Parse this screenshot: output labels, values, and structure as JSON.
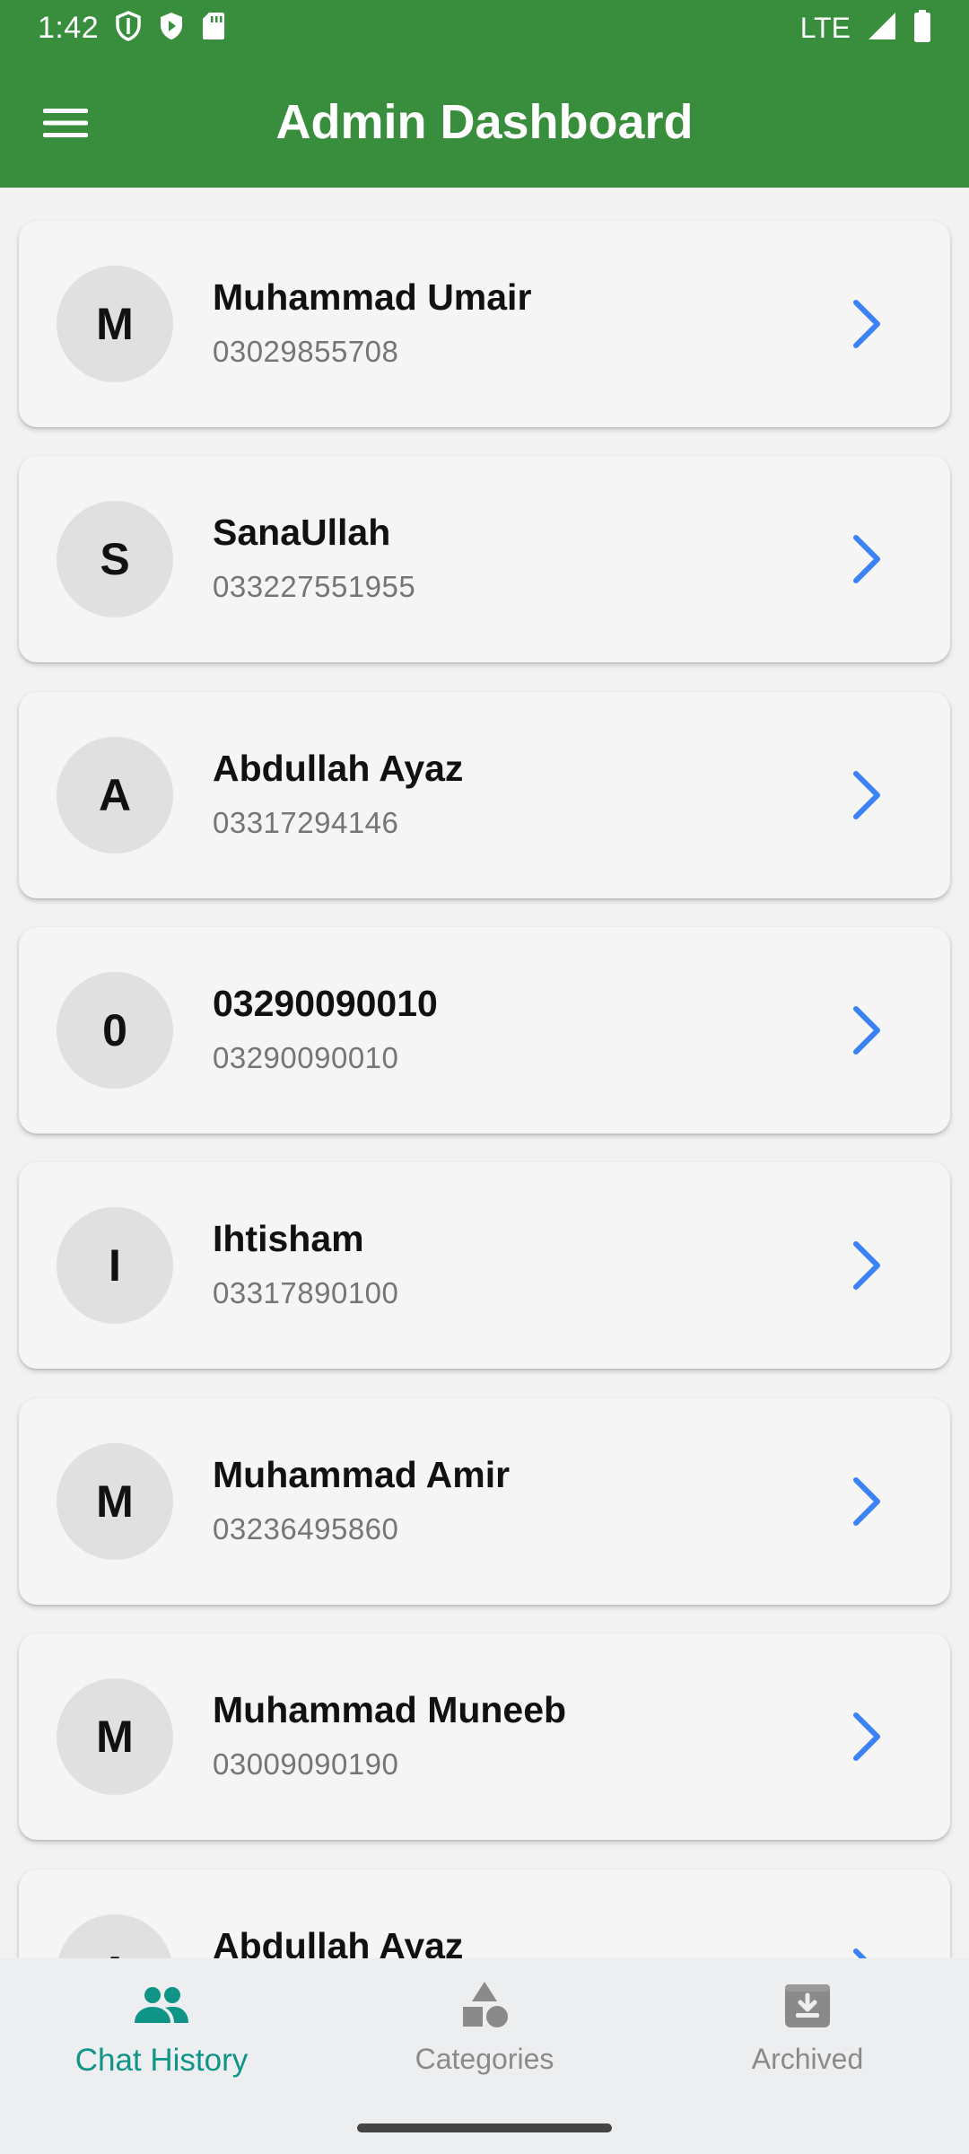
{
  "status_bar": {
    "time": "1:42",
    "network": "LTE",
    "icons": [
      "shield-icon",
      "play-protect-icon",
      "sd-card-icon",
      "signal-icon",
      "battery-icon"
    ]
  },
  "app_bar": {
    "title": "Admin Dashboard",
    "menu_icon": "hamburger-menu-icon",
    "color": "#388e3c"
  },
  "contacts": [
    {
      "initial": "M",
      "name": "Muhammad Umair",
      "phone": "03029855708"
    },
    {
      "initial": "S",
      "name": "SanaUllah",
      "phone": "033227551955"
    },
    {
      "initial": "A",
      "name": "Abdullah Ayaz",
      "phone": "03317294146"
    },
    {
      "initial": "0",
      "name": "03290090010",
      "phone": "03290090010"
    },
    {
      "initial": "I",
      "name": "Ihtisham",
      "phone": "03317890100"
    },
    {
      "initial": "M",
      "name": "Muhammad Amir",
      "phone": "03236495860"
    },
    {
      "initial": "M",
      "name": "Muhammad Muneeb",
      "phone": "03009090190"
    },
    {
      "initial": "A",
      "name": "Abdullah Ayaz",
      "phone": ""
    }
  ],
  "chevron_color": "#3b82f6",
  "bottom_nav": {
    "items": [
      {
        "label": "Chat History",
        "icon": "people-icon",
        "active": true
      },
      {
        "label": "Categories",
        "icon": "shapes-icon",
        "active": false
      },
      {
        "label": "Archived",
        "icon": "archive-icon",
        "active": false
      }
    ],
    "active_color": "#0f9488"
  }
}
